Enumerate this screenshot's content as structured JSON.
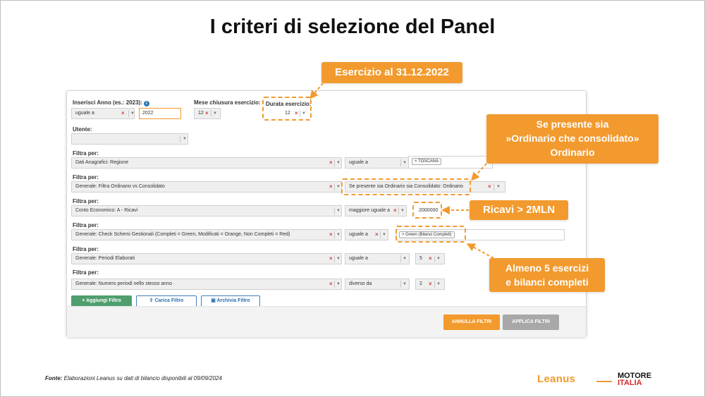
{
  "slide_title": "I criteri di selezione del Panel",
  "form": {
    "anno": {
      "label": "Inserisci Anno (es.: 2023):",
      "operator": "uguale a",
      "value": "2022"
    },
    "mese": {
      "label": "Mese chiusura esercizio:",
      "value": "12"
    },
    "durata": {
      "label": "Durata esercizio:",
      "value": "12"
    },
    "utente": {
      "label": "Utente:",
      "value": ""
    },
    "filters": [
      {
        "label": "Filtra per:",
        "field": "Dati Anagrafici: Regione",
        "operator": "uguale a",
        "value": "TOSCANA"
      },
      {
        "label": "Filtra per:",
        "field": "Generale: Filtra Ordinario vs Consolidato",
        "operator": "Se presente sia Ordinario sia Consolidato: Ordinario",
        "value": ""
      },
      {
        "label": "Filtra per:",
        "field": "Conto Economico: A - Ricavi",
        "operator": "maggiore uguale a",
        "value": "2000000"
      },
      {
        "label": "Filtra per:",
        "field": "Generale: Check Schemi Gestionali (Completi = Green, Modificati = Orange, Non Completi = Red)",
        "operator": "uguale a",
        "value": "Green (Bilanci Completi)"
      },
      {
        "label": "Filtra per:",
        "field": "Generale: Periodi Elaborati",
        "operator": "uguale a",
        "value": "5"
      },
      {
        "label": "Filtra per:",
        "field": "Generale: Numero periodi nello stesso anno",
        "operator": "diverso da",
        "value": "2"
      }
    ],
    "buttons": {
      "add": "+ Aggiungi Filtro",
      "load": "Carica Filtro",
      "archive": "Archivia Filtro",
      "cancel": "ANNULLA FILTRI",
      "apply": "APPLICA FILTRI"
    }
  },
  "callouts": {
    "esercizio": "Esercizio al 31.12.2022",
    "ordinario_l1": "Se presente sia",
    "ordinario_l2": "»Ordinario che consolidato»",
    "ordinario_l3": "Ordinario",
    "ricavi": "Ricavi > 2MLN",
    "almeno_l1": "Almeno 5 esercizi",
    "almeno_l2": "e bilanci completi"
  },
  "footer": {
    "source_label": "Fonte:",
    "source_text": "Elaborazioni Leanus su dati di bilancio disponibili al 09/09/2024",
    "brand": "Leanus",
    "partner_l1": "MOTORE",
    "partner_l2": "ITALIA"
  },
  "colors": {
    "accent": "#f29a2e",
    "green": "#4f9e6d",
    "blue": "#2a6fb5",
    "clear": "#d64040"
  },
  "icons": [
    "info-icon",
    "clear-icon",
    "dropdown-icon",
    "upload-icon",
    "save-icon"
  ]
}
